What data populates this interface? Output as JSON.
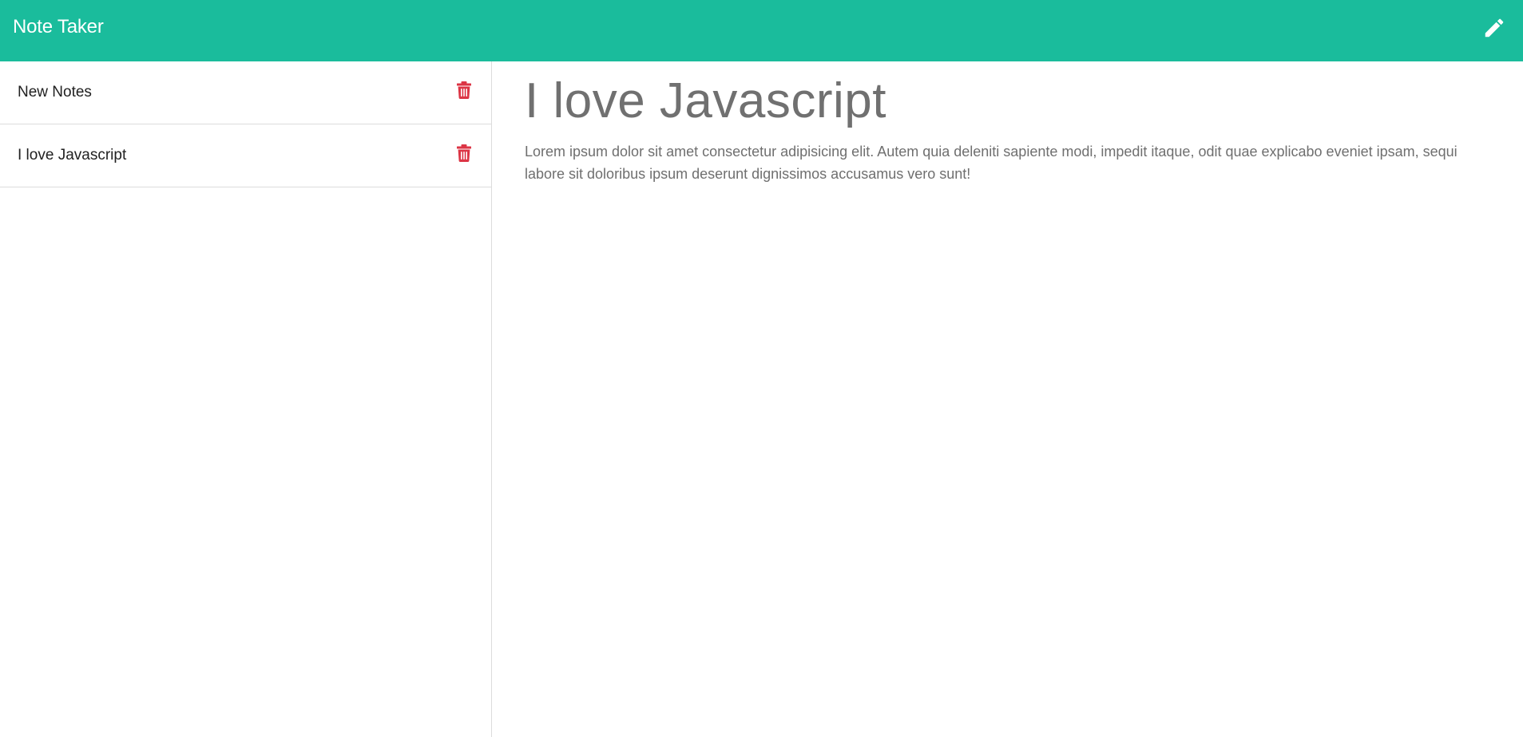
{
  "navbar": {
    "brand": "Note Taker",
    "new_note_icon": "pencil-icon",
    "color": "#1abc9c"
  },
  "sidebar": {
    "notes": [
      {
        "title": "New Notes",
        "delete_icon": "trash-icon"
      },
      {
        "title": "I love Javascript",
        "delete_icon": "trash-icon"
      }
    ],
    "delete_color": "#dc3545"
  },
  "main": {
    "title": "I love Javascript",
    "body": "Lorem ipsum dolor sit amet consectetur adipisicing elit. Autem quia deleniti sapiente modi, impedit itaque, odit quae explicabo eveniet ipsam, sequi labore sit doloribus ipsum deserunt dignissimos accusamus vero sunt!"
  }
}
